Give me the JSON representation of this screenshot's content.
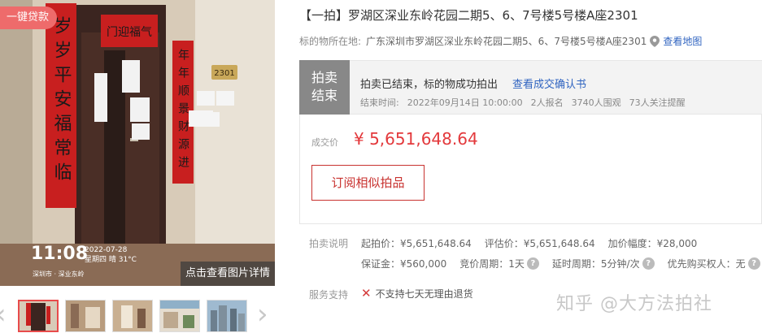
{
  "photo": {
    "badge": "一键贷款",
    "time": "11:08",
    "date": "2022-07-28",
    "weekday": "星期四 晴 31°C",
    "location": "深圳市 · 深业东岭",
    "view_detail": "点击查看图片详情",
    "door_plate": "2301",
    "couplet_left": "岁岁平安福常临",
    "couplet_right": "年年顺景财源进",
    "couplet_top": "门迎福气"
  },
  "thumbnails": {
    "prev_icon": "chevron-left-icon",
    "next_icon": "chevron-right-icon",
    "count": 5
  },
  "title": "【一拍】罗湖区深业东岭花园二期5、6、7号楼5号楼A座2301",
  "address": {
    "label": "标的物所在地:",
    "value": "广东深圳市罗湖区深业东岭花园二期5、6、7号楼5号楼A座2301",
    "map_link": "查看地图"
  },
  "status": {
    "tag_line1": "拍卖",
    "tag_line2": "结束",
    "message": "拍卖已结束，标的物成功拍出",
    "confirm_link": "查看成交确认书",
    "end_time_label": "结束时间:",
    "end_time": "2022年09月14日 10:00:00",
    "signups": "2人报名",
    "views": "3740人围观",
    "follows": "73人关注提醒"
  },
  "price": {
    "label": "成交价",
    "value": "¥ 5,651,648.64"
  },
  "subscribe_button": "订阅相似拍品",
  "auction_info": {
    "label": "拍卖说明",
    "starting_price": "起拍价：¥5,651,648.64",
    "appraisal_price": "评估价：¥5,651,648.64",
    "increment": "加价幅度：¥28,000",
    "deposit": "保证金：¥560,000",
    "bid_cycle": "竞价周期：1天",
    "delay_cycle": "延时周期：5分钟/次",
    "priority_buyer": "优先购买权人：无"
  },
  "service": {
    "label": "服务支持",
    "no_return": "不支持七天无理由退货"
  },
  "watermark": "知乎 @大方法拍社"
}
